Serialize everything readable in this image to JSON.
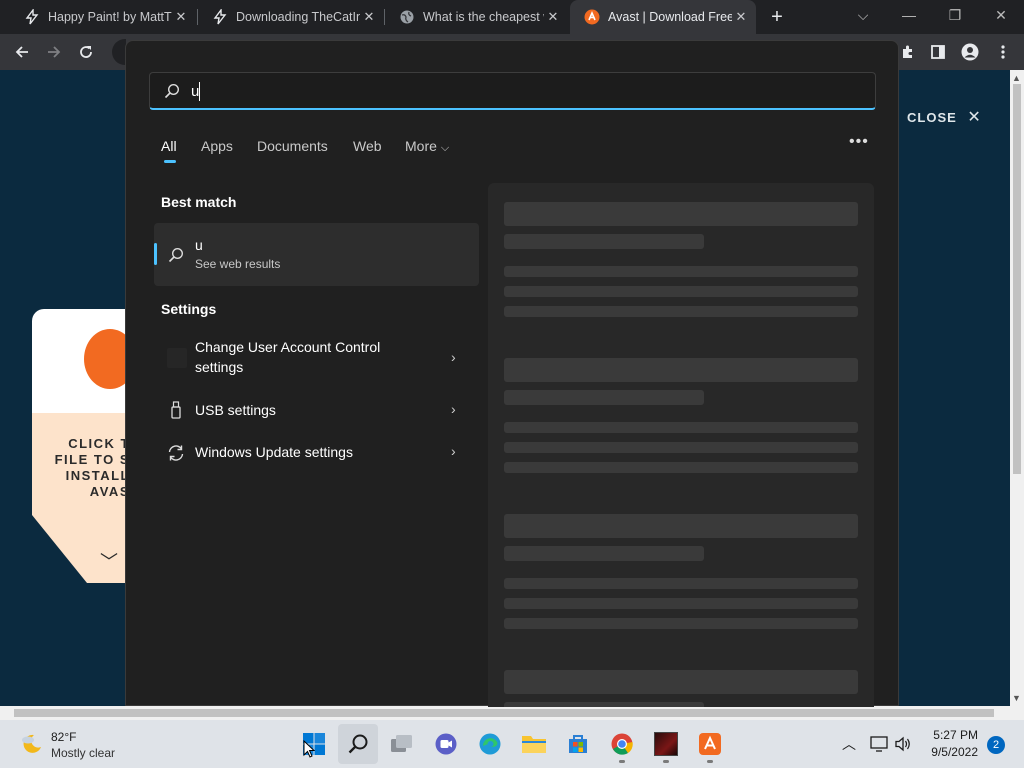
{
  "browser": {
    "tabs": [
      {
        "title": "Happy Paint! by MattTi",
        "favicon": "bolt-icon"
      },
      {
        "title": "Downloading TheCatIn",
        "favicon": "bolt-icon"
      },
      {
        "title": "What is the cheapest w",
        "favicon": "globe-icon"
      },
      {
        "title": "Avast | Download Free",
        "favicon": "avast-icon"
      }
    ],
    "new_tab_symbol": "+"
  },
  "page": {
    "close_label": "CLOSE",
    "card_lines": [
      "CLICK T",
      "FILE TO S",
      "INSTALL",
      "AVAS"
    ]
  },
  "search": {
    "query": "u",
    "filters": [
      "All",
      "Apps",
      "Documents",
      "Web",
      "More"
    ],
    "best_match_heading": "Best match",
    "best_match": {
      "title": "u",
      "subtitle": "See web results"
    },
    "settings_heading": "Settings",
    "settings_items": [
      {
        "line1": "Change User Account Control",
        "line2": "settings"
      },
      {
        "line1": "USB settings"
      },
      {
        "line1": "Windows Update settings"
      }
    ]
  },
  "taskbar": {
    "weather_temp": "82°F",
    "weather_desc": "Mostly clear",
    "time": "5:27 PM",
    "date": "9/5/2022",
    "notification_count": "2"
  },
  "colors": {
    "accent": "#4cc2ff",
    "avast_orange": "#f26a21"
  }
}
